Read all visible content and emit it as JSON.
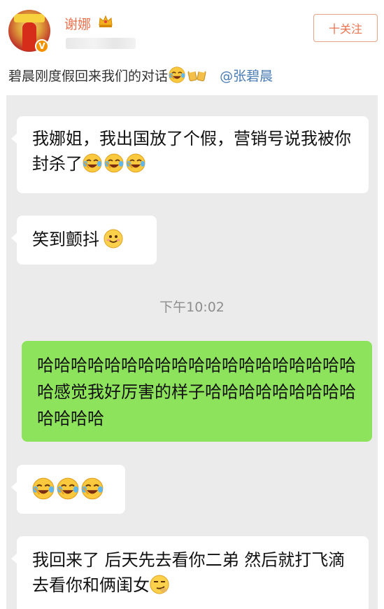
{
  "post": {
    "username": "谢娜",
    "follow_label": "十关注",
    "caption_text": "碧晨刚度假回来我们的对话",
    "mention": "@张碧晨"
  },
  "chat": {
    "timestamp": "下午10:02",
    "messages": [
      {
        "side": "incoming",
        "text": "我娜姐，我出国放了个假，营销号说我被你封杀了",
        "emojis": [
          "crying-laugh",
          "crying-laugh",
          "crying-laugh"
        ]
      },
      {
        "side": "incoming",
        "text": "笑到颤抖",
        "emojis": [
          "smile"
        ]
      },
      {
        "side": "outgoing",
        "text": "哈哈哈哈哈哈哈哈哈哈哈哈哈哈哈哈哈哈哈哈感觉我好厉害的样子哈哈哈哈哈哈哈哈哈哈哈哈哈",
        "emojis": []
      },
      {
        "side": "incoming",
        "text": "",
        "emojis": [
          "crying-laugh",
          "crying-laugh",
          "crying-laugh"
        ]
      },
      {
        "side": "incoming",
        "text": "我回来了 后天先去看你二弟 然后就打飞滴去看你和俩闺女",
        "emojis": [
          "smirk"
        ]
      }
    ]
  },
  "colors": {
    "accent": "#eb7350",
    "link": "#4a7db5",
    "outgoing_bubble": "#8ee35c",
    "incoming_bubble": "#ffffff",
    "chat_background": "#ebebeb",
    "timestamp": "#8e8e8e"
  }
}
